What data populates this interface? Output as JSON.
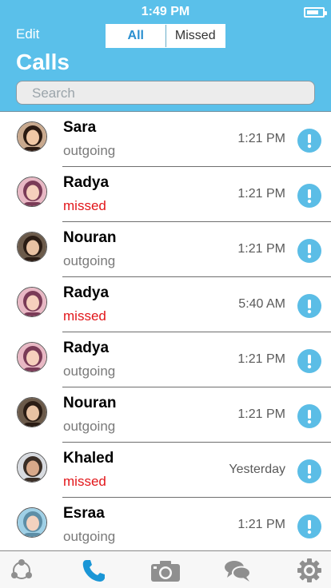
{
  "status_bar": {
    "time": "1:49 PM"
  },
  "header": {
    "edit_label": "Edit",
    "title": "Calls",
    "segments": {
      "all": "All",
      "missed": "Missed",
      "selected": "All"
    },
    "search_placeholder": "Search"
  },
  "calls": [
    {
      "name": "Sara",
      "type": "outgoing",
      "missed": false,
      "time": "1:21 PM"
    },
    {
      "name": "Radya",
      "type": "missed",
      "missed": true,
      "time": "1:21 PM"
    },
    {
      "name": "Nouran",
      "type": "outgoing",
      "missed": false,
      "time": "1:21 PM"
    },
    {
      "name": "Radya",
      "type": "missed",
      "missed": true,
      "time": "5:40 AM"
    },
    {
      "name": "Radya",
      "type": "outgoing",
      "missed": false,
      "time": "1:21 PM"
    },
    {
      "name": "Nouran",
      "type": "outgoing",
      "missed": false,
      "time": "1:21 PM"
    },
    {
      "name": "Khaled",
      "type": "missed",
      "missed": true,
      "time": "Yesterday"
    },
    {
      "name": "Esraa",
      "type": "outgoing",
      "missed": false,
      "time": "1:21 PM"
    }
  ],
  "tab_bar": {
    "items": [
      {
        "icon": "contacts-icon",
        "active": false
      },
      {
        "icon": "phone-icon",
        "active": true
      },
      {
        "icon": "camera-icon",
        "active": false
      },
      {
        "icon": "chats-icon",
        "active": false
      },
      {
        "icon": "settings-icon",
        "active": false
      }
    ]
  },
  "colors": {
    "header": "#5ac0ea",
    "accent": "#2a8fd0",
    "missed": "#e2161a",
    "info_button": "#5bbde6",
    "inactive_tab": "#8f8f8f"
  }
}
